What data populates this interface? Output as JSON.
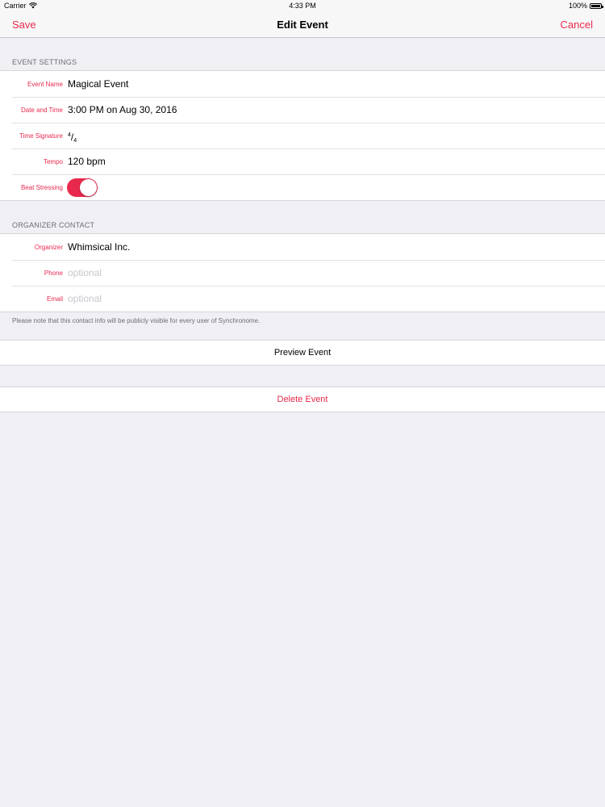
{
  "status_bar": {
    "carrier": "Carrier",
    "time": "4:33 PM",
    "battery": "100%"
  },
  "nav": {
    "left_button": "Save",
    "title": "Edit Event",
    "right_button": "Cancel"
  },
  "colors": {
    "accent": "#e8294e",
    "background": "#efeff4",
    "placeholder": "#c7c7cd"
  },
  "event_settings": {
    "header": "EVENT SETTINGS",
    "event_name_label": "Event Name",
    "event_name_value": "Magical Event",
    "date_time_label": "Date and Time",
    "date_time_value": "3:00 PM on Aug 30, 2016",
    "time_signature_label": "Time Signature",
    "time_signature_numerator": "4",
    "time_signature_slash": "/",
    "time_signature_denominator": "4",
    "tempo_label": "Tempo",
    "tempo_value": "120 bpm",
    "beat_stressing_label": "Beat Stressing",
    "beat_stressing_on": true
  },
  "organizer_contact": {
    "header": "ORGANIZER CONTACT",
    "organizer_label": "Organizer",
    "organizer_value": "Whimsical Inc.",
    "phone_label": "Phone",
    "phone_placeholder": "optional",
    "email_label": "Email",
    "email_placeholder": "optional",
    "note": "Please note that this contact info will be publicly visible for every user of Synchronome."
  },
  "actions": {
    "preview": "Preview Event",
    "delete": "Delete Event"
  }
}
